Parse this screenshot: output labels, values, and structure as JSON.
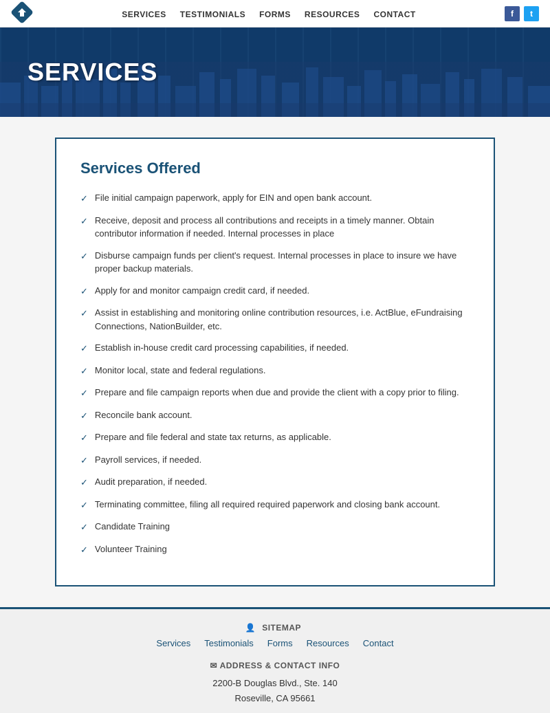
{
  "nav": {
    "logo_alt": "Logo",
    "links": [
      {
        "label": "SERVICES",
        "href": "#"
      },
      {
        "label": "TESTIMONIALS",
        "href": "#"
      },
      {
        "label": "FORMS",
        "href": "#"
      },
      {
        "label": "RESOURCES",
        "href": "#"
      },
      {
        "label": "CONTACT",
        "href": "#"
      }
    ],
    "social": [
      {
        "label": "Facebook",
        "icon": "f",
        "href": "#"
      },
      {
        "label": "Twitter",
        "icon": "t",
        "href": "#"
      }
    ]
  },
  "hero": {
    "title": "SERVICES"
  },
  "services": {
    "heading": "Services Offered",
    "items": [
      "File initial campaign paperwork, apply for EIN and open bank account.",
      "Receive, deposit and process all contributions and receipts in a timely manner. Obtain contributor information if needed. Internal processes in place",
      "Disburse campaign funds per client's request. Internal processes in place to insure we have proper backup materials.",
      "Apply for and monitor campaign credit card, if needed.",
      "Assist in establishing and monitoring online contribution resources, i.e. ActBlue, eFundraising Connections, NationBuilder, etc.",
      "Establish in-house credit card processing capabilities, if needed.",
      "Monitor local, state and federal regulations.",
      "Prepare and file campaign reports when due and provide the client with a copy prior to filing.",
      "Reconcile bank account.",
      "Prepare and file federal and state tax returns, as applicable.",
      "Payroll services, if needed.",
      "Audit preparation, if needed.",
      "Terminating committee, filing all required required paperwork and closing bank account.",
      "Candidate Training",
      "Volunteer Training"
    ]
  },
  "footer": {
    "sitemap_label": "SITEMAP",
    "sitemap_icon": "👤",
    "nav_links": [
      {
        "label": "Services",
        "href": "#"
      },
      {
        "label": "Testimonials",
        "href": "#"
      },
      {
        "label": "Forms",
        "href": "#"
      },
      {
        "label": "Resources",
        "href": "#"
      },
      {
        "label": "Contact",
        "href": "#"
      }
    ],
    "contact_label": "ADDRESS & CONTACT INFO",
    "contact_icon": "✉",
    "address_line1": "2200-B Douglas Blvd., Ste. 140",
    "address_line2": "Roseville, CA 95661"
  }
}
